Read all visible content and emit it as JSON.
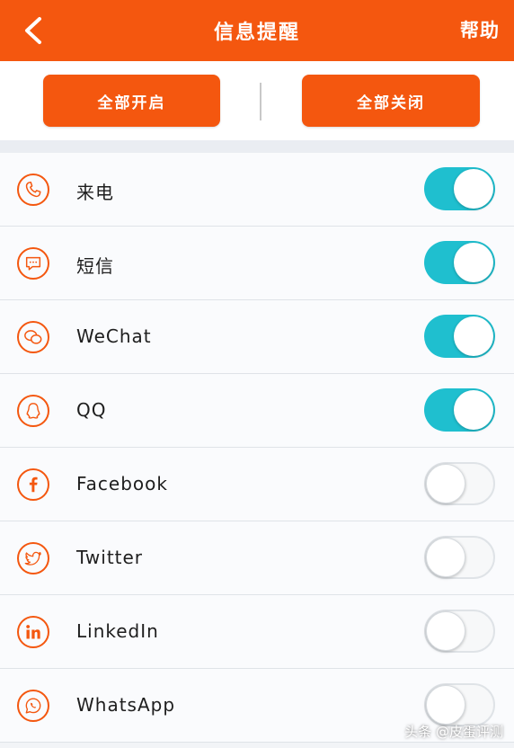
{
  "header": {
    "title": "信息提醒",
    "help_label": "帮助",
    "back_icon": "chevron-left-icon",
    "bg_color": "#f4570f"
  },
  "actions": {
    "enable_all_label": "全部开启",
    "disable_all_label": "全部关闭"
  },
  "items": [
    {
      "label": "来电",
      "icon": "phone-icon",
      "enabled": true
    },
    {
      "label": "短信",
      "icon": "message-icon",
      "enabled": true
    },
    {
      "label": "WeChat",
      "icon": "wechat-icon",
      "enabled": true
    },
    {
      "label": "QQ",
      "icon": "qq-icon",
      "enabled": true
    },
    {
      "label": "Facebook",
      "icon": "facebook-icon",
      "enabled": false
    },
    {
      "label": "Twitter",
      "icon": "twitter-icon",
      "enabled": false
    },
    {
      "label": "LinkedIn",
      "icon": "linkedin-icon",
      "enabled": false
    },
    {
      "label": "WhatsApp",
      "icon": "whatsapp-icon",
      "enabled": false
    }
  ],
  "colors": {
    "accent": "#f4570f",
    "toggle_on": "#1fbfcf"
  },
  "watermark": "头条 @皮蛋评测"
}
